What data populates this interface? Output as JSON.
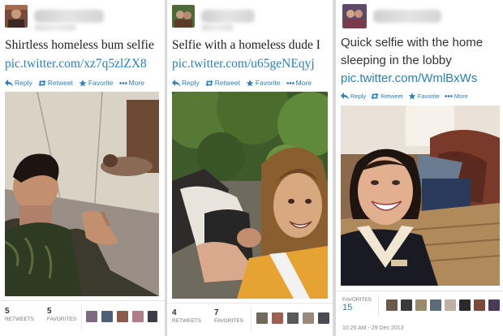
{
  "tweets": [
    {
      "text": "Shirtless homeless bum selfie",
      "link": "pic.twitter.com/xz7q5zlZX8",
      "actions": {
        "reply": "Reply",
        "retweet": "Retweet",
        "favorite": "Favorite",
        "more": "More"
      },
      "stats": [
        {
          "count": "5",
          "label": "RETWEETS"
        },
        {
          "count": "5",
          "label": "FAVORITES"
        }
      ]
    },
    {
      "text": "Selfie with a homeless dude I",
      "link": "pic.twitter.com/u65geNEqyj",
      "actions": {
        "reply": "Reply",
        "retweet": "Retweet",
        "favorite": "Favorite",
        "more": "More"
      },
      "stats": [
        {
          "count": "4",
          "label": "RETWEETS"
        },
        {
          "count": "7",
          "label": "FAVORITES"
        }
      ]
    },
    {
      "text_line1": "Quick selfie with the home",
      "text_line2": "sleeping in the lobby",
      "link": "pic.twitter.com/WmlBxWs",
      "actions": {
        "reply": "Reply",
        "retweet": "Retweet",
        "favorite": "Favorite",
        "more": "More"
      },
      "stats": [
        {
          "count": "15",
          "label": "FAVORITES"
        }
      ],
      "timestamp": "10:26 AM - 29 Dec 2013"
    }
  ],
  "colors": {
    "link": "#2a7fbf",
    "text": "#222222",
    "separator": "#d9d9d9"
  },
  "icons": [
    "reply-icon",
    "retweet-icon",
    "favorite-star-icon",
    "more-dots-icon"
  ]
}
